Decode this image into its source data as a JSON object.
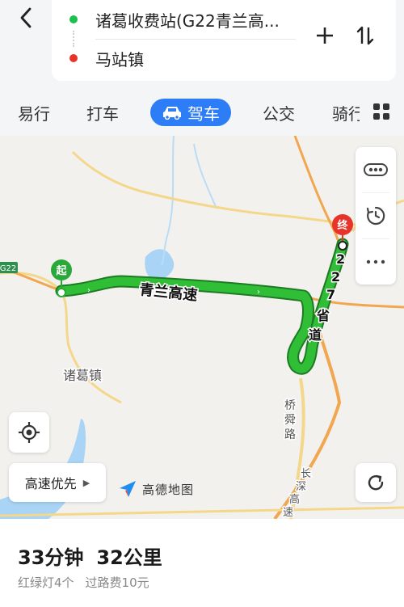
{
  "header": {
    "start": "诸葛收费站(G22青兰高...",
    "end": "马站镇"
  },
  "tabs": [
    {
      "label": "易行"
    },
    {
      "label": "打车"
    },
    {
      "label": "驾车",
      "active": true
    },
    {
      "label": "公交"
    },
    {
      "label": "骑行"
    }
  ],
  "map": {
    "labels": {
      "highway_badge": "G22",
      "start_marker": "起",
      "end_marker": "终",
      "road_main": "青兰高速",
      "road_provincial": "227省道",
      "town": "诸葛镇",
      "road_qiaoshun": "桥舜路",
      "road_changshen": "长深高速"
    },
    "route_color": "#27a82e",
    "highway_pref": "高速优先",
    "logo_text": "高德地图"
  },
  "summary": {
    "duration": "33分钟",
    "distance": "32公里",
    "traffic_lights": "红绿灯4个",
    "tolls": "过路费10元"
  }
}
